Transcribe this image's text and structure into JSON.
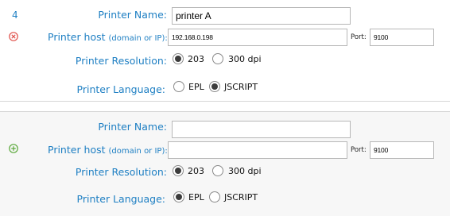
{
  "printers": [
    {
      "index": "4",
      "icon": "remove-circle-icon",
      "icon_color": "#e0504a",
      "name_label": "Printer Name:",
      "name_value": "printer A",
      "host_label": "Printer host",
      "host_hint": "(domain or IP):",
      "host_value": "192.168.0.198",
      "port_label": "Port:",
      "port_value": "9100",
      "resolution_label": "Printer Resolution:",
      "resolution_options": [
        "203",
        "300 dpi"
      ],
      "resolution_selected": "203",
      "language_label": "Printer Language:",
      "language_options": [
        "EPL",
        "JSCRIPT"
      ],
      "language_selected": "JSCRIPT"
    },
    {
      "index": "",
      "icon": "add-circle-icon",
      "icon_color": "#5aa83a",
      "name_label": "Printer Name:",
      "name_value": "",
      "host_label": "Printer host",
      "host_hint": "(domain or IP):",
      "host_value": "",
      "port_label": "Port:",
      "port_value": "9100",
      "resolution_label": "Printer Resolution:",
      "resolution_options": [
        "203",
        "300 dpi"
      ],
      "resolution_selected": "203",
      "language_label": "Printer Language:",
      "language_options": [
        "EPL",
        "JSCRIPT"
      ],
      "language_selected": "EPL"
    }
  ]
}
